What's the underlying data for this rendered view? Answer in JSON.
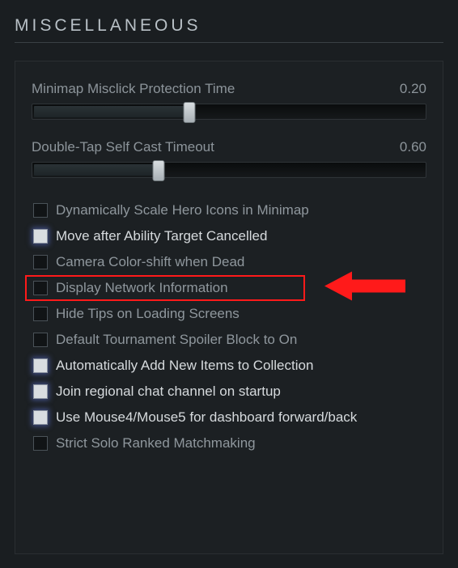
{
  "section": {
    "title": "MISCELLANEOUS"
  },
  "sliders": [
    {
      "label": "Minimap Misclick Protection Time",
      "value": "0.20",
      "percent": 40
    },
    {
      "label": "Double-Tap Self Cast Timeout",
      "value": "0.60",
      "percent": 32
    }
  ],
  "options": [
    {
      "label": "Dynamically Scale Hero Icons in Minimap",
      "checked": false,
      "highlighted": false
    },
    {
      "label": "Move after Ability Target Cancelled",
      "checked": true,
      "highlighted": false
    },
    {
      "label": "Camera Color-shift when Dead",
      "checked": false,
      "highlighted": false
    },
    {
      "label": "Display Network Information",
      "checked": false,
      "highlighted": true
    },
    {
      "label": "Hide Tips on Loading Screens",
      "checked": false,
      "highlighted": false
    },
    {
      "label": "Default Tournament Spoiler Block to On",
      "checked": false,
      "highlighted": false
    },
    {
      "label": "Automatically Add New Items to Collection",
      "checked": true,
      "highlighted": false
    },
    {
      "label": "Join regional chat channel on startup",
      "checked": true,
      "highlighted": false
    },
    {
      "label": "Use Mouse4/Mouse5 for dashboard forward/back",
      "checked": true,
      "highlighted": false
    },
    {
      "label": "Strict Solo Ranked Matchmaking",
      "checked": false,
      "highlighted": false
    }
  ]
}
